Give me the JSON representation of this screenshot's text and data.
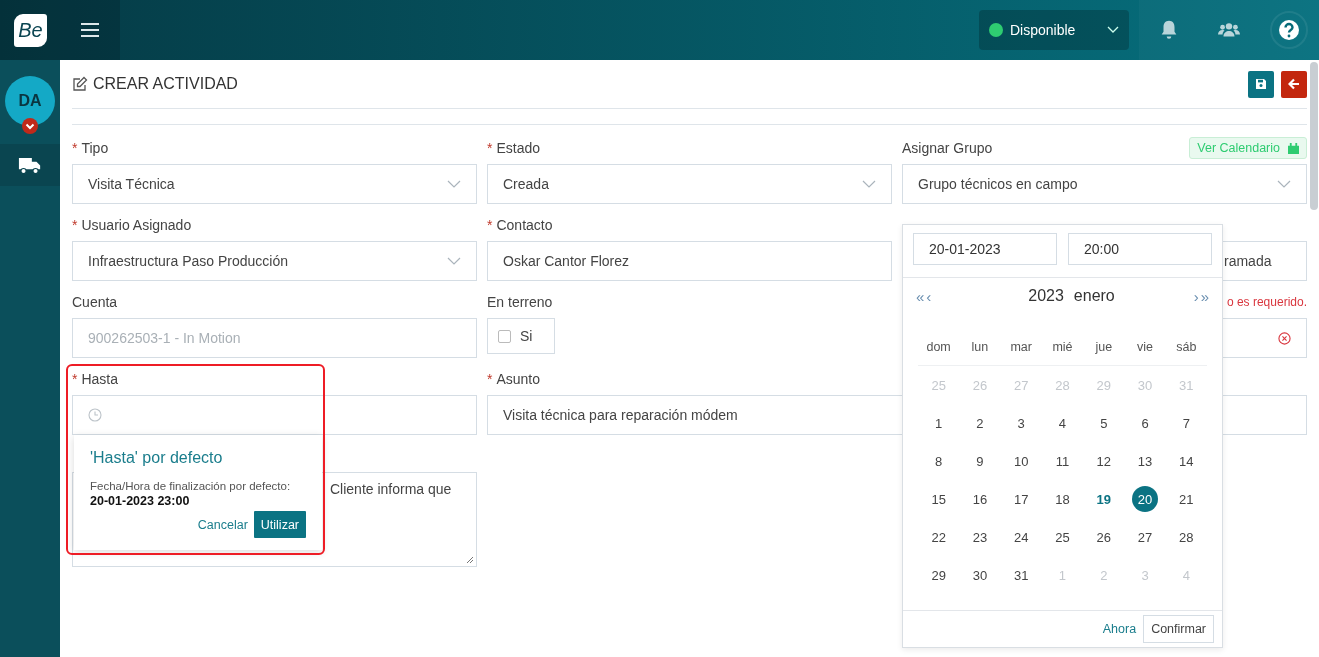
{
  "topbar": {
    "logo": "Be",
    "status": {
      "label": "Disponible",
      "color": "#2ecc71"
    }
  },
  "sidebar": {
    "avatar": "DA"
  },
  "page": {
    "title": "CREAR ACTIVIDAD",
    "calendar_button": "Ver Calendario"
  },
  "fields": [
    {
      "kind": "select",
      "marker": "*",
      "label": "Tipo",
      "value": "Visita Técnica"
    },
    {
      "kind": "select",
      "marker": "*",
      "label": "Estado",
      "value": "Creada"
    },
    {
      "kind": "select",
      "label": "Asignar Grupo",
      "value": "Grupo técnicos en campo",
      "calendar": true
    },
    {
      "kind": "select",
      "marker": "*",
      "label": "Usuario Asignado",
      "value": "Infraestructura Paso Producción"
    },
    {
      "kind": "text",
      "marker": "*",
      "label": "Contacto",
      "value": "Oskar Cantor Florez"
    },
    {
      "kind": "text",
      "value": "ramada",
      "covered": true
    },
    {
      "kind": "text",
      "label": "Cuenta",
      "value": "900262503-1  - In Motion",
      "disabled": true
    },
    {
      "kind": "checkbox",
      "label": "En terreno",
      "value": "Si",
      "checked": false
    },
    {
      "kind": "clearable",
      "error": "o es requerido."
    },
    {
      "kind": "clock",
      "marker": "*",
      "label": "Hasta"
    },
    {
      "kind": "text",
      "marker": "*",
      "label": "Asunto",
      "value": "Visita técnica para reparación módem",
      "wide": true
    },
    {
      "kind": "textarea",
      "value": "Cliente informa que",
      "covered": true
    }
  ],
  "popover": {
    "title": "'Hasta' por defecto",
    "text": "Fecha/Hora de finalización por defecto:",
    "value": "20-01-2023 23:00",
    "buttons": [
      "Cancelar",
      "Utilizar"
    ]
  },
  "datepicker": {
    "date": "20-01-2023",
    "time": "20:00",
    "nav_back": [
      "«",
      "‹"
    ],
    "year": "2023",
    "month": "enero",
    "nav_forward": [
      "›",
      "»"
    ],
    "weekdays": [
      "dom",
      "lun",
      "mar",
      "mié",
      "jue",
      "vie",
      "sáb"
    ],
    "days": [
      {
        "label": "25",
        "muted": true,
        "selected": false,
        "today": false
      },
      {
        "label": "26",
        "muted": true,
        "selected": false,
        "today": false
      },
      {
        "label": "27",
        "muted": true,
        "selected": false,
        "today": false
      },
      {
        "label": "28",
        "muted": true,
        "selected": false,
        "today": false
      },
      {
        "label": "29",
        "muted": true,
        "selected": false,
        "today": false
      },
      {
        "label": "30",
        "muted": true,
        "selected": false,
        "today": false
      },
      {
        "label": "31",
        "muted": true,
        "selected": false,
        "today": false
      },
      {
        "label": "1",
        "muted": false,
        "selected": false,
        "today": false
      },
      {
        "label": "2",
        "muted": false,
        "selected": false,
        "today": false
      },
      {
        "label": "3",
        "muted": false,
        "selected": false,
        "today": false
      },
      {
        "label": "4",
        "muted": false,
        "selected": false,
        "today": false
      },
      {
        "label": "5",
        "muted": false,
        "selected": false,
        "today": false
      },
      {
        "label": "6",
        "muted": false,
        "selected": false,
        "today": false
      },
      {
        "label": "7",
        "muted": false,
        "selected": false,
        "today": false
      },
      {
        "label": "8",
        "muted": false,
        "selected": false,
        "today": false
      },
      {
        "label": "9",
        "muted": false,
        "selected": false,
        "today": false
      },
      {
        "label": "10",
        "muted": false,
        "selected": false,
        "today": false
      },
      {
        "label": "11",
        "muted": false,
        "selected": false,
        "today": false
      },
      {
        "label": "12",
        "muted": false,
        "selected": false,
        "today": false
      },
      {
        "label": "13",
        "muted": false,
        "selected": false,
        "today": false
      },
      {
        "label": "14",
        "muted": false,
        "selected": false,
        "today": false
      },
      {
        "label": "15",
        "muted": false,
        "selected": false,
        "today": false
      },
      {
        "label": "16",
        "muted": false,
        "selected": false,
        "today": false
      },
      {
        "label": "17",
        "muted": false,
        "selected": false,
        "today": false
      },
      {
        "label": "18",
        "muted": false,
        "selected": false,
        "today": false
      },
      {
        "label": "19",
        "muted": false,
        "selected": false,
        "today": true
      },
      {
        "label": "20",
        "muted": false,
        "selected": true,
        "today": false
      },
      {
        "label": "21",
        "muted": false,
        "selected": false,
        "today": false
      },
      {
        "label": "22",
        "muted": false,
        "selected": false,
        "today": false
      },
      {
        "label": "23",
        "muted": false,
        "selected": false,
        "today": false
      },
      {
        "label": "24",
        "muted": false,
        "selected": false,
        "today": false
      },
      {
        "label": "25",
        "muted": false,
        "selected": false,
        "today": false
      },
      {
        "label": "26",
        "muted": false,
        "selected": false,
        "today": false
      },
      {
        "label": "27",
        "muted": false,
        "selected": false,
        "today": false
      },
      {
        "label": "28",
        "muted": false,
        "selected": false,
        "today": false
      },
      {
        "label": "29",
        "muted": false,
        "selected": false,
        "today": false
      },
      {
        "label": "30",
        "muted": false,
        "selected": false,
        "today": false
      },
      {
        "label": "31",
        "muted": false,
        "selected": false,
        "today": false
      },
      {
        "label": "1",
        "muted": true,
        "selected": false,
        "today": false
      },
      {
        "label": "2",
        "muted": true,
        "selected": false,
        "today": false
      },
      {
        "label": "3",
        "muted": true,
        "selected": false,
        "today": false
      },
      {
        "label": "4",
        "muted": true,
        "selected": false,
        "today": false
      }
    ],
    "footer": [
      "Ahora",
      "Confirmar"
    ]
  }
}
